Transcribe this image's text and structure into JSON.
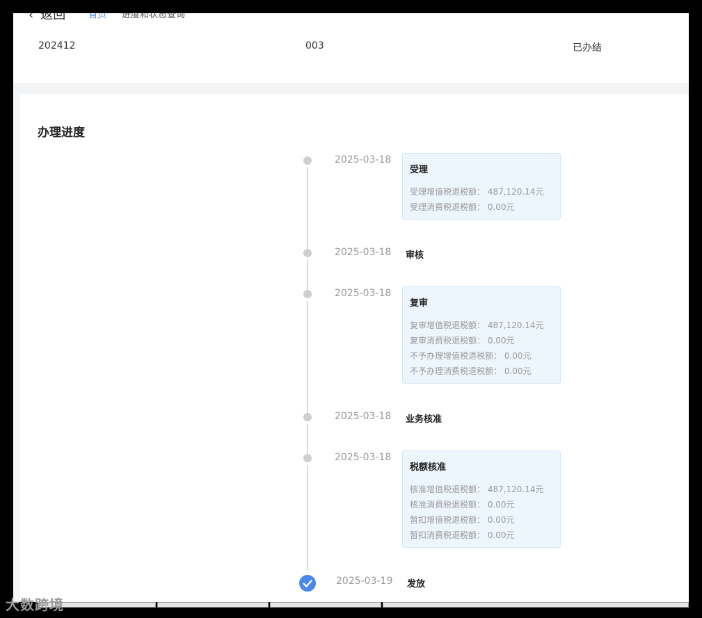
{
  "header": {
    "back_label": "返回",
    "breadcrumb_home": "首页",
    "breadcrumb_current": "进度和状态查询"
  },
  "record": {
    "period": "202412",
    "sequence": "003",
    "status": "已办结"
  },
  "progress": {
    "title": "办理进度",
    "steps": [
      {
        "date": "2025-03-18",
        "title": "受理",
        "lines": [
          "受理增值税退税额： 487,120.14元",
          "受理消费税退税额： 0.00元"
        ]
      },
      {
        "date": "2025-03-18",
        "title": "审核"
      },
      {
        "date": "2025-03-18",
        "title": "复审",
        "lines": [
          "复审增值税退税额： 487,120.14元",
          "复审消费税退税额： 0.00元",
          "不予办理增值税退税额： 0.00元",
          "不予办理消费税退税额： 0.00元"
        ]
      },
      {
        "date": "2025-03-18",
        "title": "业务核准"
      },
      {
        "date": "2025-03-18",
        "title": "税额核准",
        "lines": [
          "核准增值税退税额： 487,120.14元",
          "核准消费税退税额： 0.00元",
          "暂扣增值税退税额： 0.00元",
          "暂扣消费税退税额： 0.00元"
        ]
      },
      {
        "date": "2025-03-19",
        "title": "发放"
      }
    ]
  },
  "watermark": "大数跨境",
  "colors": {
    "accent": "#4a87e8",
    "box_bg": "#eef6fd",
    "dot": "#cfcfcf"
  }
}
